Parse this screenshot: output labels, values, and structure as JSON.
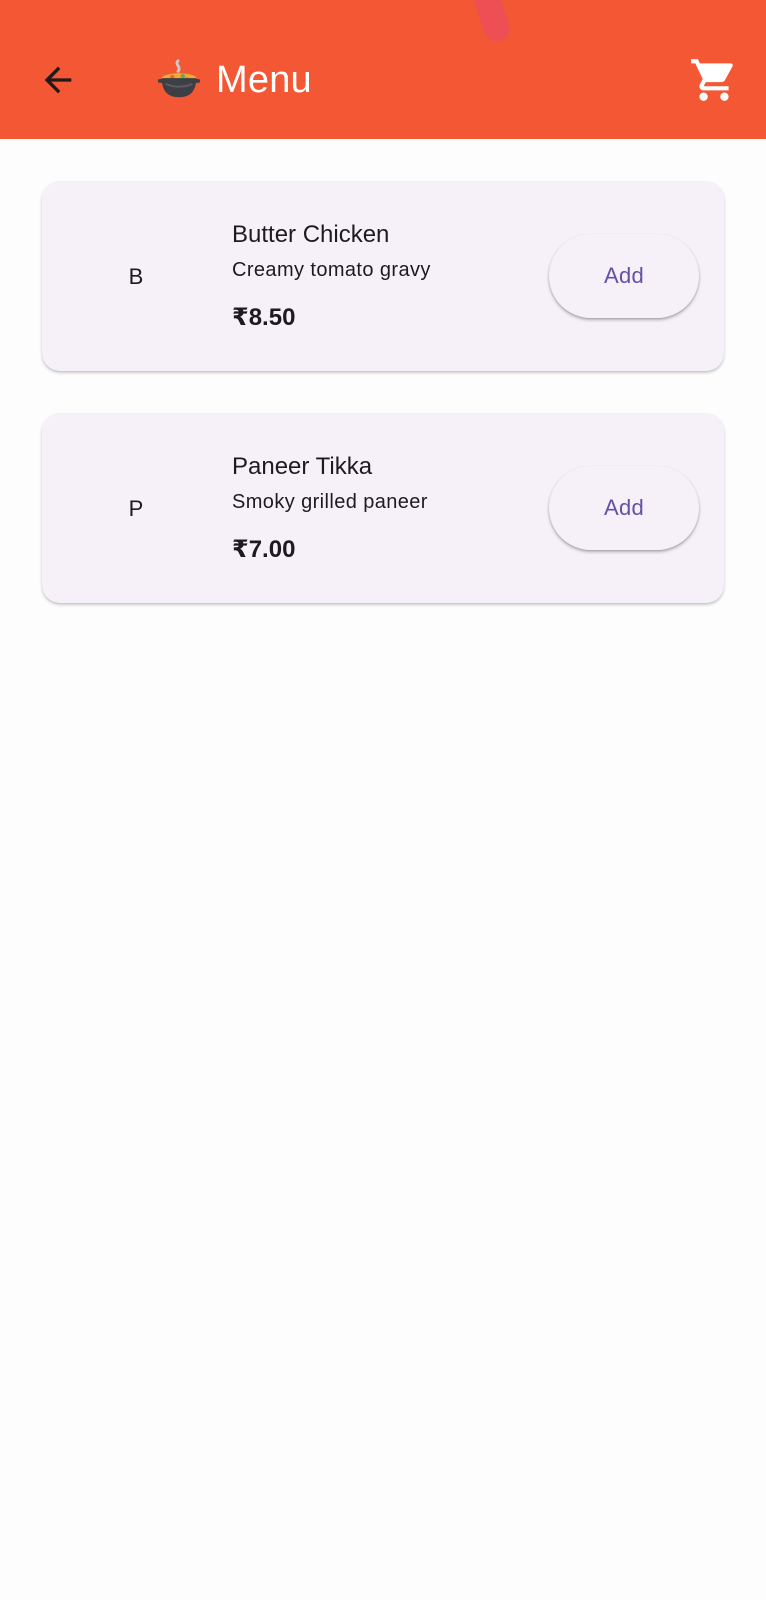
{
  "app_bar": {
    "title": "Menu",
    "title_icon": "pot-of-food-icon",
    "back_icon": "arrow-back-icon",
    "cart_icon": "shopping-cart-icon",
    "background_color": "#f35733"
  },
  "menu": {
    "items": [
      {
        "initial": "B",
        "name": "Butter Chicken",
        "description": "Creamy tomato gravy",
        "price": "₹8.50",
        "add_label": "Add"
      },
      {
        "initial": "P",
        "name": "Paneer Tikka",
        "description": "Smoky grilled paneer",
        "price": "₹7.00",
        "add_label": "Add"
      }
    ]
  },
  "colors": {
    "card_background": "#f6f1f9",
    "button_text": "#6750a4",
    "text_primary": "#1d1b20"
  }
}
